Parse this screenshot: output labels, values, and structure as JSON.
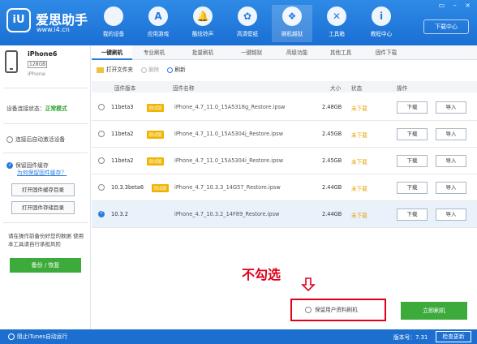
{
  "app": {
    "logo_mark": "iU",
    "title": "爱思助手",
    "url": "www.i4.cn",
    "download_center": "下载中心",
    "window_controls": "▭ – ×"
  },
  "nav": [
    {
      "label": "我的设备",
      "icon": ""
    },
    {
      "label": "应用游戏",
      "icon": "A"
    },
    {
      "label": "酷炫铃声",
      "icon": "🔔"
    },
    {
      "label": "高清壁纸",
      "icon": "✿"
    },
    {
      "label": "刷机越狱",
      "icon": "❖"
    },
    {
      "label": "工具箱",
      "icon": "✕"
    },
    {
      "label": "教程中心",
      "icon": "i"
    }
  ],
  "device": {
    "name": "iPhone6",
    "capacity": "128GB",
    "model": "iPhone"
  },
  "sidebar": {
    "status_label": "设备连接状态：",
    "status_value": "正常模式",
    "auto_activate": "连接后自动激活设备",
    "keep_cache": "保留固件缓存",
    "cache_link": "为何保留固件缓存？",
    "open_cache_dir": "打开固件缓存目录",
    "open_storage_dir": "打开固件存储目录",
    "warning": "请在操作前备份好您的数据 使用本工具请自行承担风险",
    "backup": "备份 / 恢复"
  },
  "tabs": [
    "一键刷机",
    "专业刷机",
    "批量刷机",
    "一键越狱",
    "高级功能",
    "其他工具",
    "固件下载"
  ],
  "toolbar": {
    "open_folder": "打开文件夹",
    "delete": "删除",
    "refresh": "刷新"
  },
  "table": {
    "headers": {
      "version": "固件版本",
      "name": "固件名称",
      "size": "大小",
      "state": "状态",
      "action": "操作"
    },
    "rows": [
      {
        "version": "11beta3",
        "tag": "测试版",
        "name": "iPhone_4.7_11.0_15A5318g_Restore.ipsw",
        "size": "2.48GB",
        "state": "未下载",
        "download": "下载",
        "import": "导入"
      },
      {
        "version": "11beta2",
        "tag": "测试版",
        "name": "iPhone_4.7_11.0_15A5304j_Restore.ipsw",
        "size": "2.45GB",
        "state": "未下载",
        "download": "下载",
        "import": "导入"
      },
      {
        "version": "11beta2",
        "tag": "测试版",
        "name": "iPhone_4.7_11.0_15A5304i_Restore.ipsw",
        "size": "2.45GB",
        "state": "未下载",
        "download": "下载",
        "import": "导入"
      },
      {
        "version": "10.3.3beta6",
        "tag": "测试版",
        "name": "iPhone_4.7_10.3.3_14G57_Restore.ipsw",
        "size": "2.44GB",
        "state": "未下载",
        "download": "下载",
        "import": "导入"
      },
      {
        "version": "10.3.2",
        "tag": "",
        "name": "iPhone_4.7_10.3.2_14F89_Restore.ipsw",
        "size": "2.44GB",
        "state": "未下载",
        "download": "下载",
        "import": "导入"
      }
    ]
  },
  "annotation": "不勾选",
  "keep_user_data": "保留用户资料刷机",
  "flash_now": "立即刷机",
  "footer": {
    "block_itunes": "阻止iTunes自动运行",
    "version": "版本号：7.31",
    "check_update": "检查更新"
  },
  "colors": {
    "brand_blue": "#1a6fd3",
    "success_green": "#3cab3c",
    "status_orange": "#e8a000",
    "annotation_red": "#e0001a"
  }
}
